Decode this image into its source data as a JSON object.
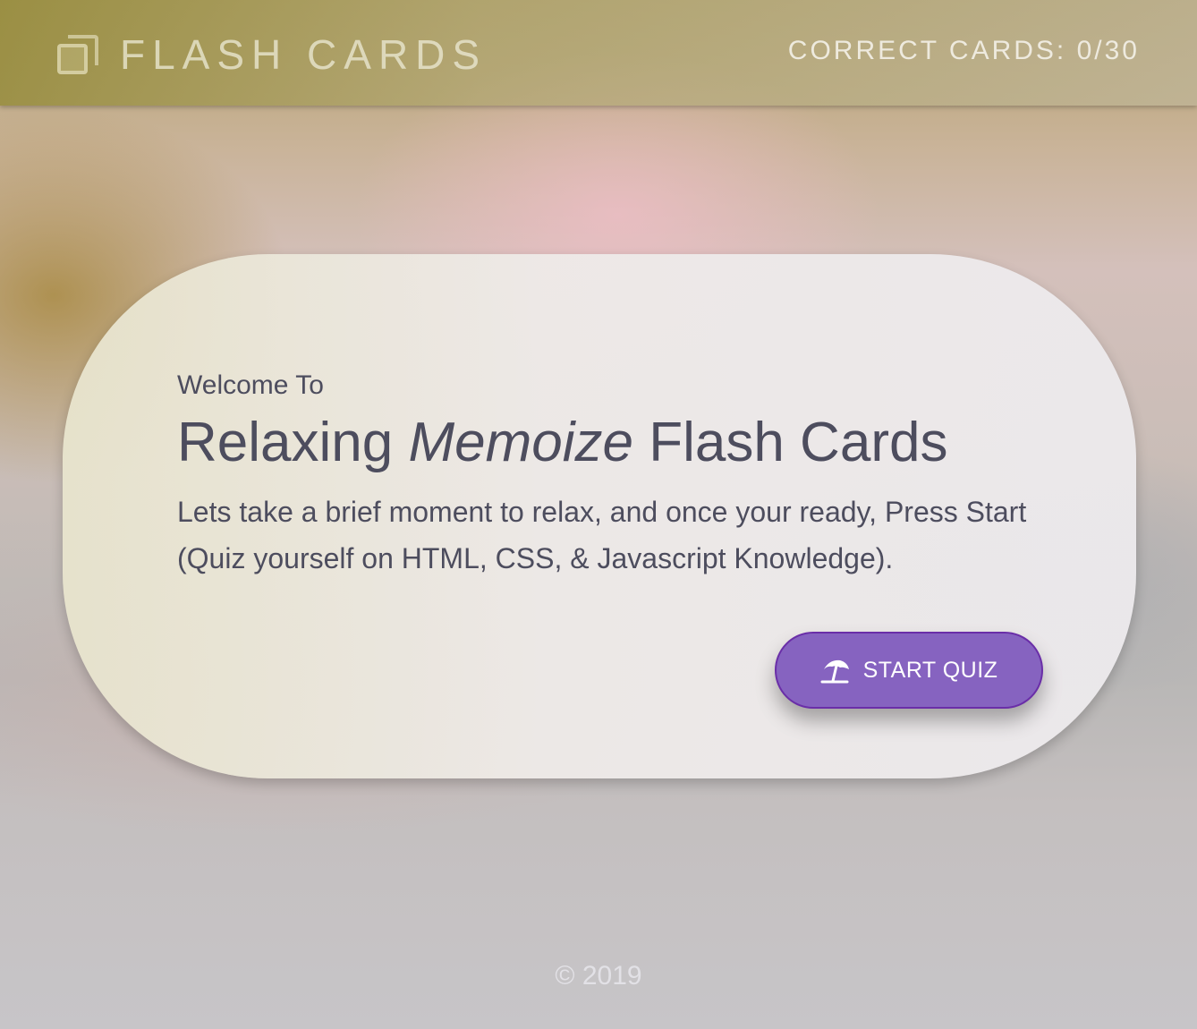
{
  "header": {
    "logo_icon": "cards-stack-icon",
    "app_title": "FLASH CARDS",
    "score_text": "CORRECT CARDS: 0/30"
  },
  "card": {
    "welcome": "Welcome To",
    "title_part1": "Relaxing ",
    "title_em": "Memoize",
    "title_part2": " Flash Cards",
    "description": "Lets take a brief moment to relax, and once your ready, Press Start (Quiz yourself on HTML, CSS, & Javascript Knowledge).",
    "start_button": {
      "icon": "beach-umbrella-icon",
      "label": "START QUIZ",
      "color": "#8663c0"
    }
  },
  "footer": {
    "copyright": "© 2019"
  }
}
